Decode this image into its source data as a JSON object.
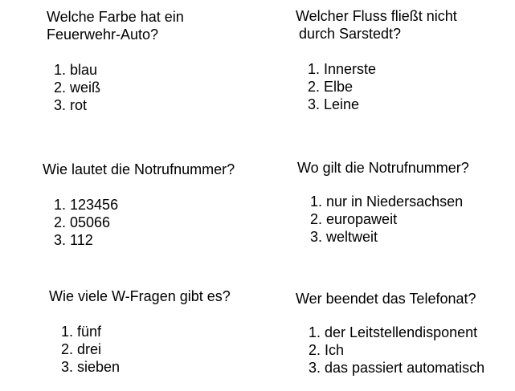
{
  "cards": [
    {
      "question": [
        "Welche Farbe hat ein",
        "Feuerwehr-Auto?"
      ],
      "options": [
        "1. blau",
        "2. weiß",
        "3. rot"
      ]
    },
    {
      "question": [
        "Welcher Fluss fließt nicht",
        "durch Sarstedt?"
      ],
      "options": [
        "1. Innerste",
        "2. Elbe",
        "3. Leine"
      ]
    },
    {
      "question": [
        "Wie lautet die Notrufnummer?"
      ],
      "options": [
        "1. 123456",
        "2. 05066",
        "3. 112"
      ]
    },
    {
      "question": [
        "Wo gilt die Notrufnummer?"
      ],
      "options": [
        "1. nur in Niedersachsen",
        "2. europaweit",
        "3. weltweit"
      ]
    },
    {
      "question": [
        "Wie viele W-Fragen gibt es?"
      ],
      "options": [
        "1. fünf",
        "2. drei",
        "3. sieben"
      ]
    },
    {
      "question": [
        "Wer beendet das Telefonat?"
      ],
      "options": [
        "1. der Leitstellendisponent",
        "2. Ich",
        "3. das passiert automatisch"
      ]
    }
  ]
}
